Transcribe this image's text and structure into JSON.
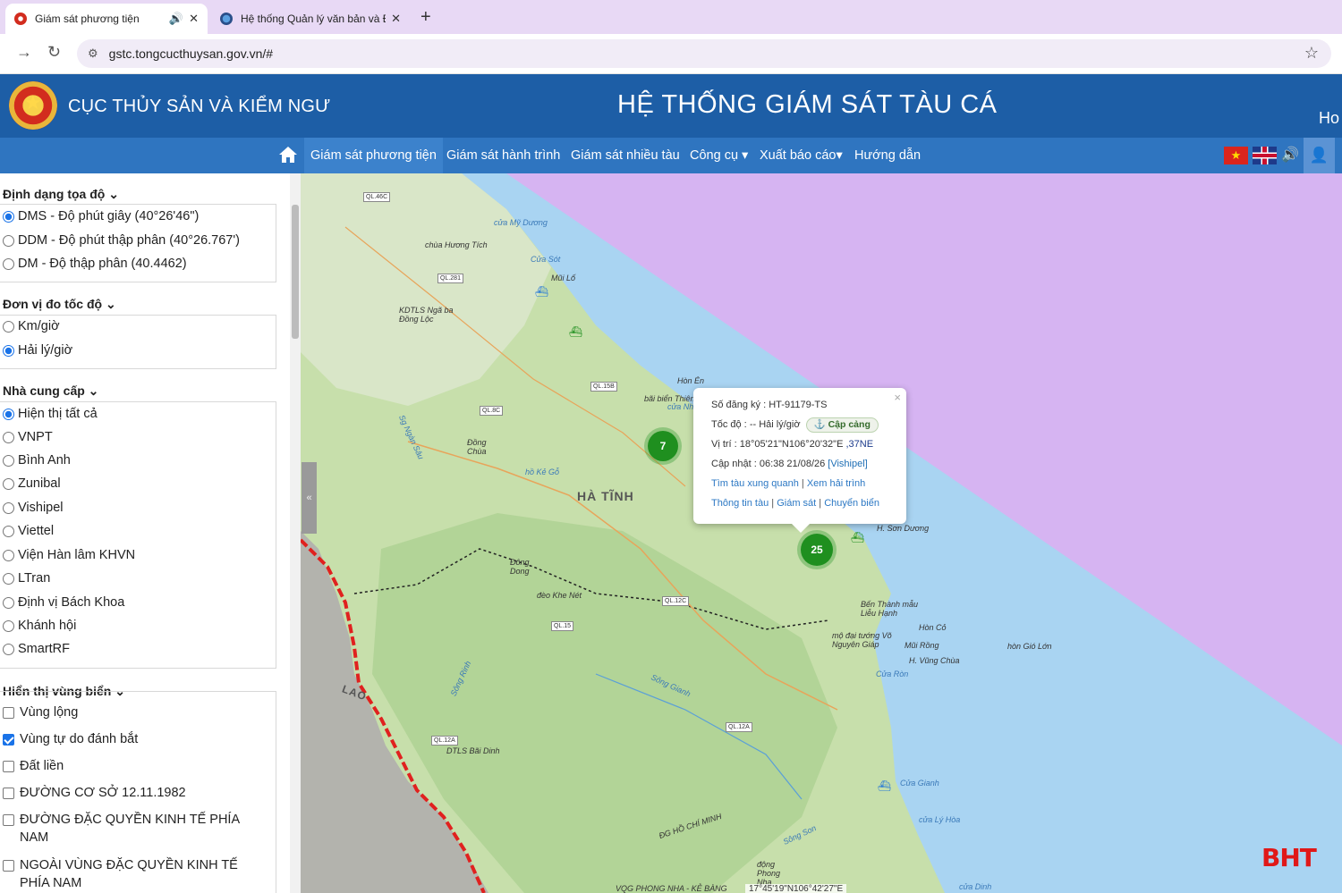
{
  "browser": {
    "tabs": [
      {
        "title": "Giám sát phương tiện",
        "audio_icon": "speaker-icon",
        "close": "✕"
      },
      {
        "title": "Hệ thống Quản lý văn bản và Đ",
        "close": "✕"
      }
    ],
    "new_tab": "+",
    "url": "gstc.tongcucthuysan.gov.vn/#"
  },
  "header": {
    "agency": "CỤC THỦY SẢN VÀ KIỂM NGƯ",
    "title": "HỆ THỐNG GIÁM SÁT TÀU CÁ",
    "cut_text": "Ho"
  },
  "nav": {
    "items": [
      {
        "label": "Giám sát phương tiện",
        "active": true
      },
      {
        "label": "Giám sát hành trình"
      },
      {
        "label": "Giám sát nhiều tàu"
      },
      {
        "label": "Công cụ ▾"
      },
      {
        "label": "Xuất báo cáo▾"
      },
      {
        "label": "Hướng dẫn"
      }
    ]
  },
  "sidebar": {
    "coord_format": {
      "heading": "Định dạng tọa độ ⌄",
      "options": [
        "DMS - Độ phút giây (40°26'46\")",
        "DDM - Độ phút thập phân (40°26.767')",
        "DM - Độ thập phân (40.4462)"
      ],
      "selected": 0
    },
    "speed_unit": {
      "heading": "Đơn vị đo tốc độ ⌄",
      "options": [
        "Km/giờ",
        "Hải lý/giờ"
      ],
      "selected": 1
    },
    "provider": {
      "heading": "Nhà cung cấp ⌄",
      "options": [
        "Hiện thị tất cả",
        "VNPT",
        "Bình Anh",
        "Zunibal",
        "Vishipel",
        "Viettel",
        "Viện Hàn lâm KHVN",
        "LTran",
        "Định vị Bách Khoa",
        "Khánh hội",
        "SmartRF"
      ],
      "selected": 0
    },
    "sea_zone": {
      "heading": "Hiển thị vùng biển ⌄",
      "options": [
        "Vùng lộng",
        "Vùng tự do đánh bắt",
        "Đất liền",
        "ĐƯỜNG CƠ SỞ 12.11.1982",
        "ĐƯỜNG ĐẶC QUYỀN KINH TẾ PHÍA NAM",
        "NGOÀI VÙNG ĐẶC QUYỀN KINH TẾ PHÍA NAM"
      ],
      "checked": [
        false,
        true,
        false,
        false,
        false,
        false
      ]
    }
  },
  "map": {
    "region_label": "HÀ TĨNH",
    "country_label": "LAO",
    "place_labels": [
      "cửa Mỹ Dương",
      "chùa Hương Tích",
      "Cửa Sót",
      "Mũi Lố",
      "KDTLS Ngã ba Đồng Lộc",
      "Hòn Én",
      "bãi biển Thiên",
      "cửa Nh",
      "Đồng Chùa",
      "hồ Kẻ Gỗ",
      "Sg Ngàn Sâu",
      "Đông Dong",
      "đèo Khe Nét",
      "H. Sơn Dương",
      "Bến Thành mẫu Liễu Hạnh",
      "mộ đại tướng Võ Nguyên Giáp",
      "Hòn Cỏ",
      "Mũi Rồng",
      "H. Vũng Chùa",
      "hòn Gió Lớn",
      "Cửa Ròn",
      "Sông Gianh",
      "DTLS Bãi Dinh",
      "Sông Rinh",
      "Cửa Gianh",
      "cửa Lý Hòa",
      "Sông Son",
      "động Phong Nha",
      "VQG PHONG NHA - KẺ BÀNG",
      "cửa Dinh",
      "ĐG HỒ CHÍ MINH"
    ],
    "road_labels": [
      "QL.46C",
      "QL.281",
      "QL.15B",
      "QL.8C",
      "QL.12C",
      "QL.15",
      "QL.12A",
      "QL.12A"
    ],
    "clusters": [
      {
        "count": "7"
      },
      {
        "count": "25"
      }
    ],
    "popup": {
      "reg_label": "Số đăng ký :",
      "reg_value": "HT-91179-TS",
      "speed_label": "Tốc độ :",
      "speed_value": "-- Hải lý/giờ",
      "status_badge": "Cập cảng",
      "pos_label": "Vị trí :",
      "pos_value": "18°05'21\"N106°20'32\"E",
      "pos_zone": ",37NE",
      "update_label": "Cập nhật :",
      "update_value": "06:38 21/08/26",
      "update_source": "[Vishipel]",
      "links_1": [
        "Tìm tàu xung quanh",
        "Xem hải trình"
      ],
      "links_2": [
        "Thông tin tàu",
        "Giám sát",
        "Chuyển biển"
      ],
      "close": "×"
    },
    "cursor_coords": "17°45'19\"N106°42'27\"E",
    "watermark": "BHT"
  },
  "colors": {
    "header": "#1d5ea6",
    "nav": "#2f75c0",
    "sea": "#a9d4f2",
    "open_sea": "#d6b4f2",
    "land": "#c7dfab",
    "border": "#e0211f"
  }
}
